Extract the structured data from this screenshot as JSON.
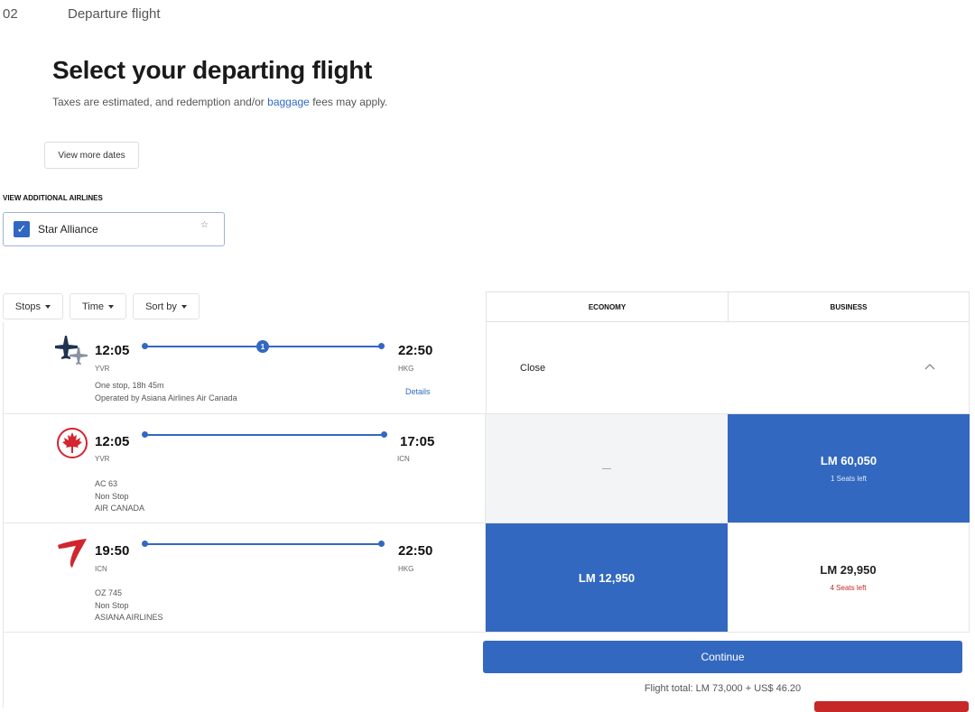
{
  "step": {
    "number": "02",
    "label": "Departure flight"
  },
  "page_title": "Select your departing flight",
  "subtitle": {
    "before": "Taxes are estimated, and redemption and/or ",
    "link": "baggage",
    "after": " fees may apply."
  },
  "view_more_dates": "View more dates",
  "additional_airlines": {
    "heading": "VIEW ADDITIONAL AIRLINES",
    "option": "Star Alliance",
    "checked": true
  },
  "filters": [
    "Stops",
    "Time",
    "Sort by"
  ],
  "cabins": [
    "ECONOMY",
    "BUSINESS"
  ],
  "colors": {
    "accent": "#3368c0",
    "warning": "#c62828"
  },
  "itinerary": {
    "depart_time": "12:05",
    "depart_code": "YVR",
    "arrive_time": "22:50",
    "arrive_code": "HKG",
    "stops": "1",
    "summary": "One stop, 18h 45m",
    "operated": "Operated by Asiana Airlines Air Canada",
    "details": "Details",
    "close": "Close"
  },
  "segments": [
    {
      "airline_icon": "air-canada-maple-leaf",
      "depart_time": "12:05",
      "depart_code": "YVR",
      "arrive_time": "17:05",
      "arrive_code": "ICN",
      "flight": "AC 63",
      "stops": "Non Stop",
      "airline": "AIR CANADA",
      "economy": {
        "price": "—",
        "selected": false
      },
      "business": {
        "price": "LM 60,050",
        "seats": "1 Seats left",
        "selected": true
      }
    },
    {
      "airline_icon": "asiana-wing",
      "depart_time": "19:50",
      "depart_code": "ICN",
      "arrive_time": "22:50",
      "arrive_code": "HKG",
      "flight": "OZ 745",
      "stops": "Non Stop",
      "airline": "ASIANA AIRLINES",
      "economy": {
        "price": "LM 12,950",
        "selected": true
      },
      "business": {
        "price": "LM 29,950",
        "seats": "4 Seats left",
        "selected": false
      }
    }
  ],
  "continue": "Continue",
  "flight_total": "Flight total: LM 73,000 + US$ 46.20"
}
